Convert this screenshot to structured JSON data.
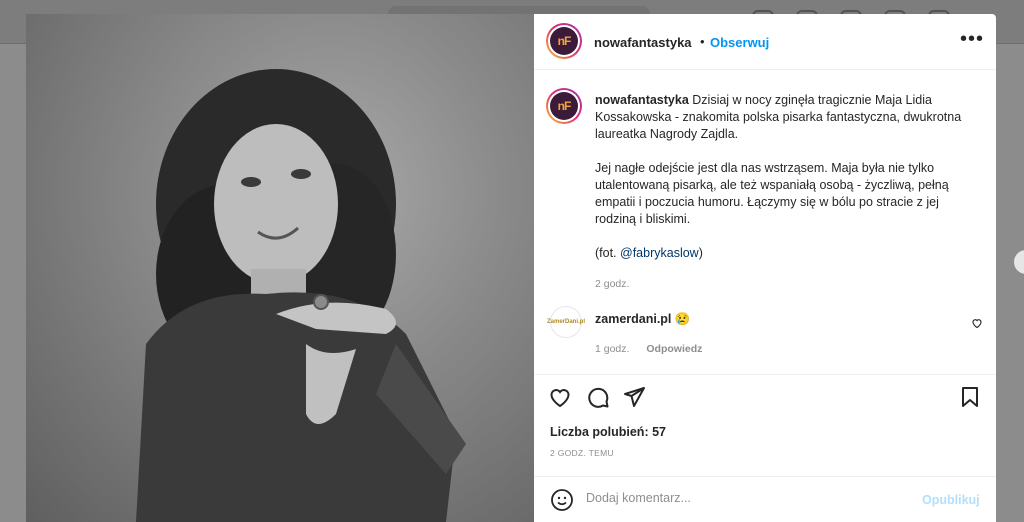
{
  "post": {
    "author": "nowafantastyka",
    "avatar_text": "nF",
    "follow_label": "Obserwuj",
    "dot": "•",
    "more_label": "•••"
  },
  "caption": {
    "author": "nowafantastyka",
    "para1": "Dzisiaj w nocy zginęła tragicznie Maja Lidia Kossakowska - znakomita polska pisarka fantastyczna, dwukrotna laureatka Nagrody Zajdla.",
    "para2": "Jej nagłe odejście jest dla nas wstrząsem. Maja była nie tylko utalentowaną pisarką, ale też wspaniałą osobą - życzliwą, pełną empatii i poczucia humoru. Łączymy się w bólu po stracie z jej rodziną i bliskimi.",
    "photo_prefix": "(fot. ",
    "photo_credit": "@fabrykaslow",
    "photo_suffix": ")",
    "time": "2 godz."
  },
  "comment": {
    "author": "zamerdani.pl",
    "emoji": "😢",
    "avatar_text": "ZamerDani.pl",
    "time": "1 godz.",
    "reply_label": "Odpowiedz"
  },
  "stats": {
    "likes": "Liczba polubień: 57",
    "posted_ago": "2 GODZ. TEMU"
  },
  "add_comment": {
    "placeholder": "Dodaj komentarz...",
    "publish_label": "Opublikuj"
  }
}
